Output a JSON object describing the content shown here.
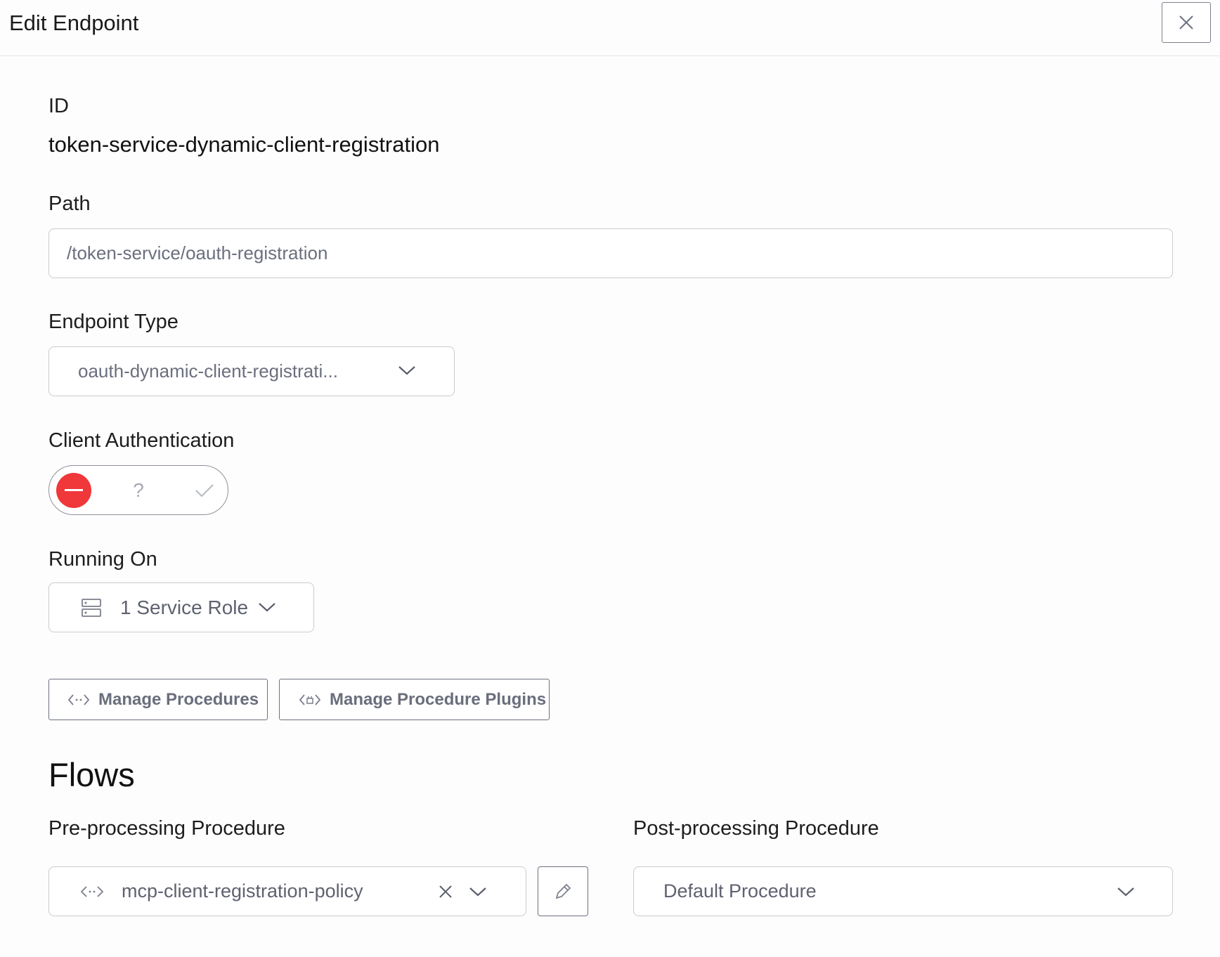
{
  "header": {
    "title": "Edit Endpoint"
  },
  "id_field": {
    "label": "ID",
    "value": "token-service-dynamic-client-registration"
  },
  "path_field": {
    "label": "Path",
    "value": "/token-service/oauth-registration"
  },
  "endpoint_type": {
    "label": "Endpoint Type",
    "selected": "oauth-dynamic-client-registrati..."
  },
  "client_auth": {
    "label": "Client Authentication",
    "options": [
      "disabled",
      "unset",
      "enabled"
    ],
    "selected": "disabled",
    "unset_glyph": "?",
    "active_color": "#f0373a"
  },
  "running_on": {
    "label": "Running On",
    "selected": "1 Service Role"
  },
  "actions": {
    "manage_procedures": "Manage Procedures",
    "manage_procedure_plugins": "Manage Procedure Plugins"
  },
  "flows": {
    "title": "Flows",
    "pre": {
      "label": "Pre-processing Procedure",
      "selected": "mcp-client-registration-policy"
    },
    "post": {
      "label": "Post-processing Procedure",
      "selected": "Default Procedure"
    }
  }
}
